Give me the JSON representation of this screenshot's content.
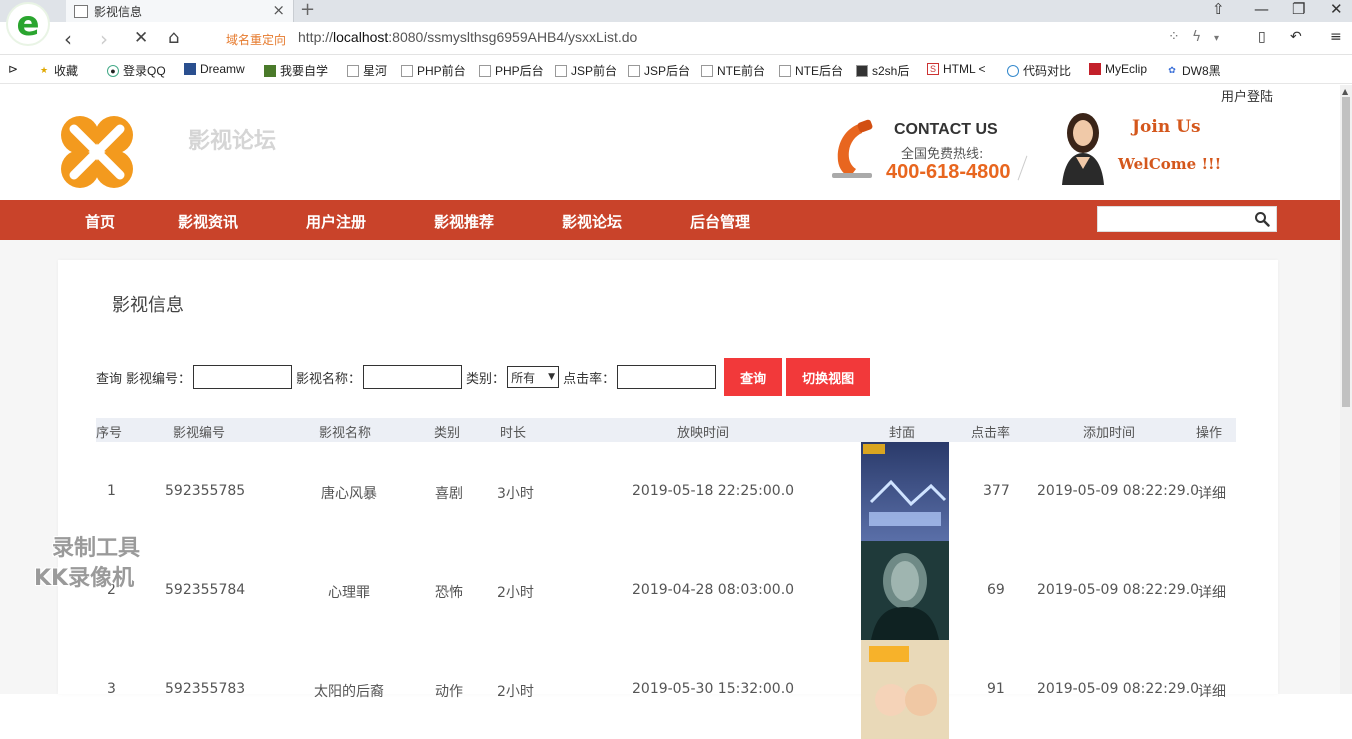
{
  "browser": {
    "tab_title": "影视信息",
    "redirect_label": "域名重定向",
    "url_prefix": "http://",
    "url_host": "localhost",
    "url_rest": ":8080/ssmyslthsg6959AHB4/ysxxList.do",
    "bookmarks": [
      "收藏",
      "登录QQ",
      "Dreamw",
      "我要自学",
      "星河",
      "PHP前台",
      "PHP后台",
      "JSP前台",
      "JSP后台",
      "NTE前台",
      "NTE后台",
      "s2sh后",
      "HTML <",
      "代码对比",
      "MyEclip",
      "DW8黑"
    ]
  },
  "header": {
    "login_link": "用户登陆",
    "site_title": "影视论坛",
    "contact_title": "CONTACT US",
    "contact_sub": "全国免费热线:",
    "contact_phone": "400-618-4800",
    "join": "Join Us",
    "welcome": "WelCome !!!"
  },
  "nav": {
    "items": [
      "首页",
      "影视资讯",
      "用户注册",
      "影视推荐",
      "影视论坛",
      "后台管理"
    ]
  },
  "main": {
    "title": "影视信息",
    "filters": {
      "prefix": "查询",
      "id_label": "影视编号：",
      "name_label": "影视名称：",
      "type_label": "类别：",
      "type_value": "所有",
      "clicks_label": "点击率：",
      "search_button": "查询",
      "switch_button": "切换视图"
    },
    "table": {
      "headers": [
        "序号",
        "影视编号",
        "影视名称",
        "类别",
        "时长",
        "放映时间",
        "封面",
        "点击率",
        "添加时间",
        "操作"
      ],
      "rows": [
        {
          "no": "1",
          "id": "592355785",
          "name": "唐心风暴",
          "type": "喜剧",
          "duration": "3小时",
          "show_time": "2019-05-18 22:25:00.0",
          "clicks": "377",
          "added": "2019-05-09 08:22:29.0",
          "action": "详细"
        },
        {
          "no": "2",
          "id": "592355784",
          "name": "心理罪",
          "type": "恐怖",
          "duration": "2小时",
          "show_time": "2019-04-28 08:03:00.0",
          "clicks": "69",
          "added": "2019-05-09 08:22:29.0",
          "action": "详细"
        },
        {
          "no": "3",
          "id": "592355783",
          "name": "太阳的后裔",
          "type": "动作",
          "duration": "2小时",
          "show_time": "2019-05-30 15:32:00.0",
          "clicks": "91",
          "added": "2019-05-09 08:22:29.0",
          "action": "详细"
        }
      ]
    }
  },
  "watermark": {
    "line1": "录制工具",
    "line2": "KK录像机"
  },
  "colors": {
    "nav_bg": "#c9432a",
    "button_bg": "#f2393a",
    "phone_orange": "#e8661f"
  }
}
